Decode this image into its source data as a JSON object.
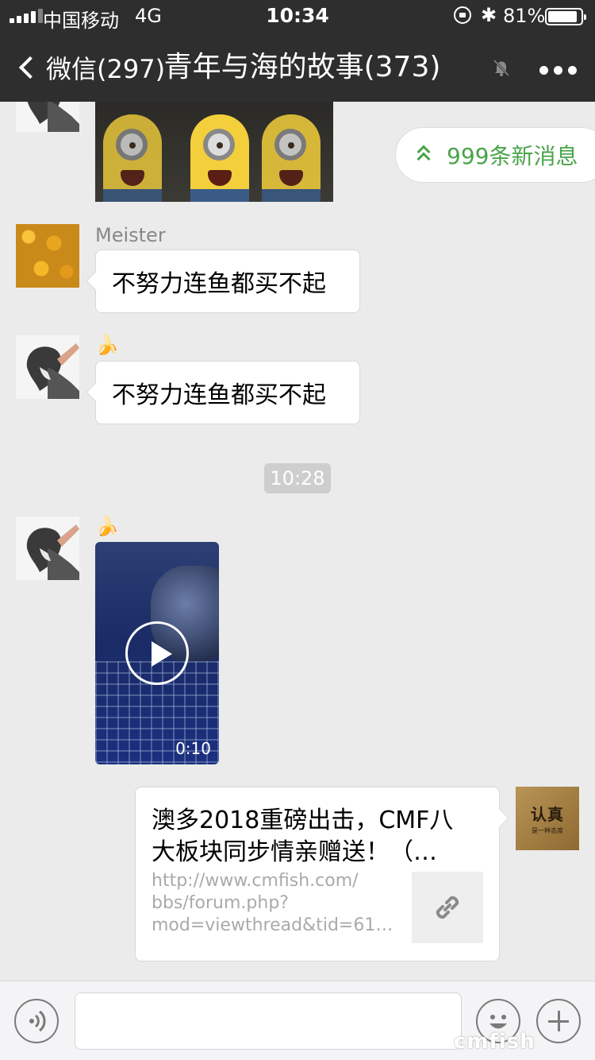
{
  "status_bar": {
    "carrier": "中国移动",
    "network": "4G",
    "time": "10:34",
    "battery_percent": "81%",
    "battery_level": 0.81
  },
  "nav": {
    "back_label": "微信(297)",
    "title": "青年与海的故事(373)",
    "icons": [
      "chevron-left-icon",
      "mute-bell-icon",
      "more-icon"
    ]
  },
  "new_messages": {
    "label": "999条新消息"
  },
  "messages": [
    {
      "kind": "image",
      "description_icon": "minions-gif"
    },
    {
      "kind": "text",
      "sender": "Meister",
      "text": "不努力连鱼都买不起"
    },
    {
      "kind": "text",
      "sender": "🍌",
      "text": "不努力连鱼都买不起"
    },
    {
      "kind": "time",
      "text": "10:28"
    },
    {
      "kind": "video",
      "sender": "🍌",
      "duration": "0:10"
    },
    {
      "kind": "link",
      "title": "澳多2018重磅出击，CMF八\n大板块同步情亲赠送！（…",
      "url": "http://www.cmfish.com/\nbbs/forum.php?\nmod=viewthread&tid=61…"
    }
  ],
  "avatar_text": {
    "big": "认真",
    "small": "是一种态度"
  },
  "input_bar": {
    "placeholder": ""
  },
  "watermark": "cmfish"
}
